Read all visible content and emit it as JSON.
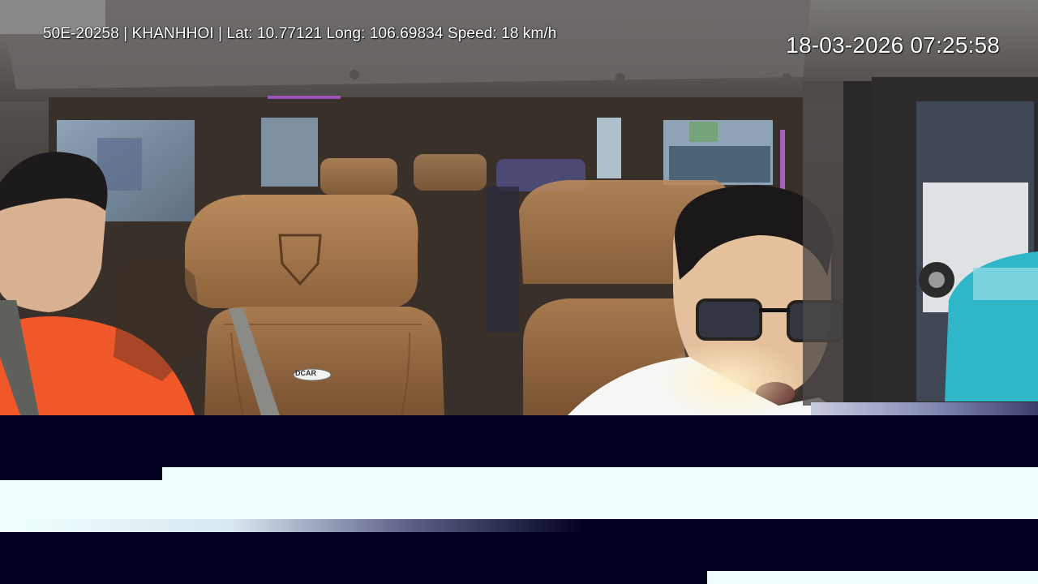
{
  "overlay": {
    "info_line": "50E-20258 | KHANHHOI | Lat: 10.77121 Long: 106.69834 Speed: 18 km/h",
    "timestamp": "18-03-2026 07:25:58"
  },
  "seat_badge": "DCAR"
}
